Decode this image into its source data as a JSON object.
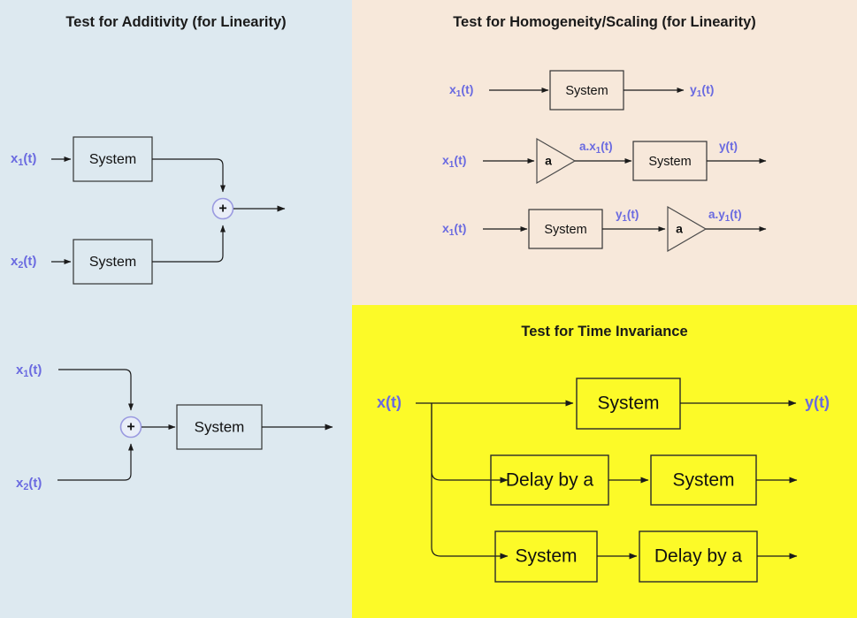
{
  "colors": {
    "panel_additivity_bg": "#dde9f0",
    "panel_homogeneity_bg": "#f7e8da",
    "panel_superposition_bg": "#dde9f0",
    "panel_timeinvariance_bg": "#fcfa28",
    "signal_label": "#6a6ae0",
    "wire": "#1a1a1a",
    "box_stroke": "#333333",
    "sum_circle_stroke": "#9a9ae0"
  },
  "panels": {
    "additivity": {
      "title": "Test for Additivity (for Linearity)",
      "inputs": [
        {
          "base": "x",
          "sub": "1",
          "tail": "(t)"
        },
        {
          "base": "x",
          "sub": "2",
          "tail": "(t)"
        }
      ],
      "blocks": [
        {
          "label": "System"
        },
        {
          "label": "System"
        }
      ],
      "operator": "+"
    },
    "homogeneity": {
      "title": "Test for Homogeneity/Scaling (for Linearity)",
      "rows": [
        {
          "input": {
            "base": "x",
            "sub": "1",
            "tail": "(t)"
          },
          "blocks": [
            {
              "type": "system",
              "label": "System"
            }
          ],
          "output": {
            "base": "y",
            "sub": "1",
            "tail": "(t)"
          },
          "mid_labels": []
        },
        {
          "input": {
            "base": "x",
            "sub": "1",
            "tail": "(t)"
          },
          "blocks": [
            {
              "type": "amplifier",
              "label": "a"
            },
            {
              "type": "system",
              "label": "System"
            }
          ],
          "output": {
            "base": "y",
            "sub": "",
            "tail": "(t)"
          },
          "mid_labels": [
            {
              "base": "a.x",
              "sub": "1",
              "tail": "(t)"
            }
          ]
        },
        {
          "input": {
            "base": "x",
            "sub": "1",
            "tail": "(t)"
          },
          "blocks": [
            {
              "type": "system",
              "label": "System"
            },
            {
              "type": "amplifier",
              "label": "a"
            }
          ],
          "output": {
            "base": "a.y",
            "sub": "1",
            "tail": "(t)"
          },
          "mid_labels": [
            {
              "base": "y",
              "sub": "1",
              "tail": "(t)"
            }
          ]
        }
      ]
    },
    "superposition": {
      "title": "",
      "inputs": [
        {
          "base": "x",
          "sub": "1",
          "tail": "(t)"
        },
        {
          "base": "x",
          "sub": "2",
          "tail": "(t)"
        }
      ],
      "operator": "+",
      "blocks": [
        {
          "label": "System"
        }
      ]
    },
    "time_invariance": {
      "title": "Test for Time Invariance",
      "input": {
        "base": "x",
        "sub": "",
        "tail": "(t)"
      },
      "output": {
        "base": "y",
        "sub": "",
        "tail": "(t)"
      },
      "rows": [
        {
          "blocks": [
            {
              "label": "System"
            }
          ]
        },
        {
          "blocks": [
            {
              "label": "Delay by a"
            },
            {
              "label": "System"
            }
          ]
        },
        {
          "blocks": [
            {
              "label": "System"
            },
            {
              "label": "Delay by a"
            }
          ]
        }
      ]
    }
  }
}
